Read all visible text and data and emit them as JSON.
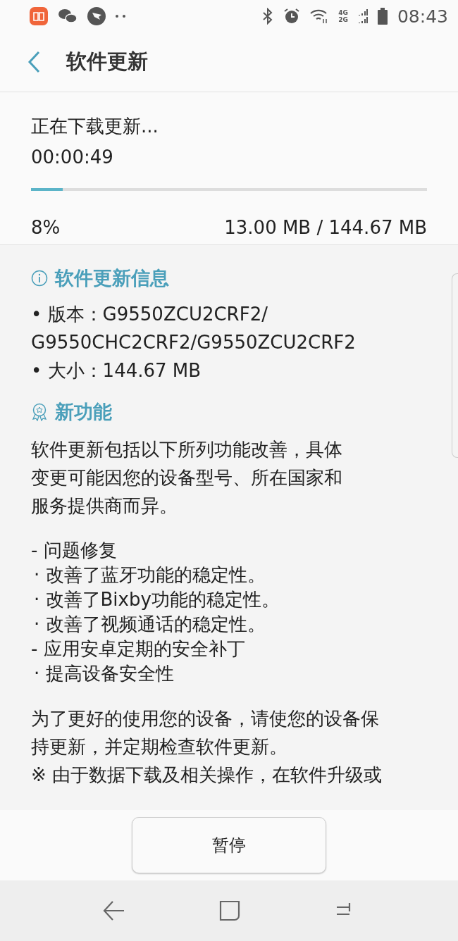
{
  "status_bar": {
    "network_labels": [
      "4G",
      "2G"
    ],
    "time": "08:43"
  },
  "header": {
    "title": "软件更新"
  },
  "download": {
    "status": "正在下载更新...",
    "elapsed": "00:00:49",
    "level": 0.08,
    "percent": "8%",
    "size": "13.00 MB / 144.67 MB"
  },
  "info": {
    "title": "软件更新信息",
    "lines": [
      "• 版本：G9550ZCU2CRF2/\nG9550CHC2CRF2/G9550ZCU2CRF2",
      "• 大小：144.67 MB"
    ]
  },
  "features": {
    "title": "新功能",
    "blocks": [
      {
        "kind": "paragraph",
        "lines": [
          "软件更新包括以下所列功能改善，具体",
          "变更可能因您的设备型号、所在国家和",
          "服务提供商而异。"
        ]
      },
      {
        "kind": "item",
        "text": "- 问题修复"
      },
      {
        "kind": "subitem",
        "text": "· 改善了蓝牙功能的稳定性。"
      },
      {
        "kind": "subitem",
        "text": "· 改善了Bixby功能的稳定性。"
      },
      {
        "kind": "subitem",
        "text": "· 改善了视频通话的稳定性。"
      },
      {
        "kind": "item",
        "text": "- 应用安卓定期的安全补丁"
      },
      {
        "kind": "subitem",
        "text": "· 提高设备安全性"
      },
      {
        "kind": "paragraph",
        "lines": [
          "为了更好的使用您的设备，请使您的设备保",
          "持更新，并定期检查软件更新。"
        ]
      },
      {
        "kind": "note",
        "text": "※ 由于数据下载及相关操作，在软件升级或"
      }
    ]
  },
  "buttons": [
    {
      "label": "暂停"
    }
  ]
}
